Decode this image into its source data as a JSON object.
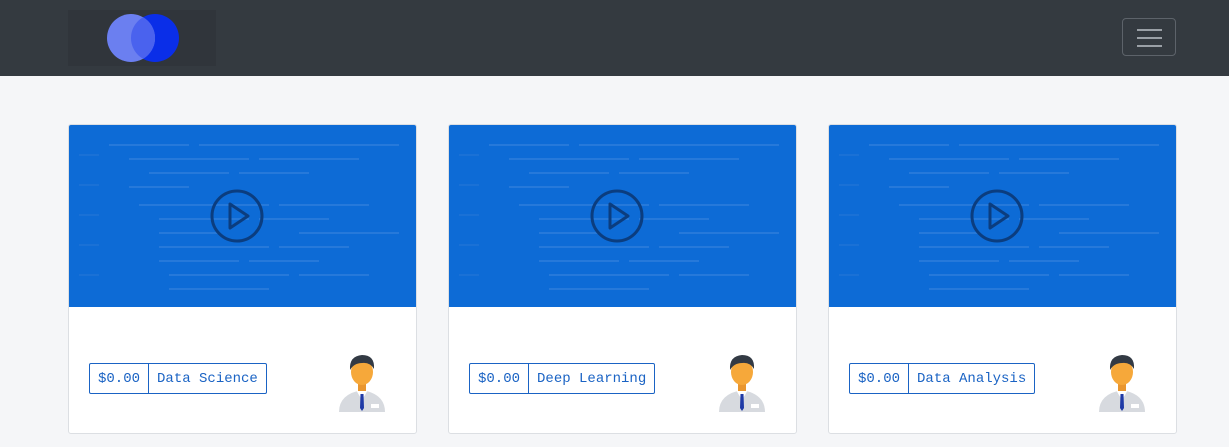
{
  "navbar": {
    "logo_icon": "overlapping-circles-logo",
    "menu_icon": "hamburger-menu-icon",
    "colors": {
      "background": "#343a40",
      "logo_left": "#6b7ff0",
      "logo_right": "#0a2ee8"
    }
  },
  "courses": [
    {
      "price": "$0.00",
      "category": "Data Science",
      "thumbnail_icon": "play-icon",
      "instructor_icon": "avatar-icon"
    },
    {
      "price": "$0.00",
      "category": "Deep Learning",
      "thumbnail_icon": "play-icon",
      "instructor_icon": "avatar-icon"
    },
    {
      "price": "$0.00",
      "category": "Data Analysis",
      "thumbnail_icon": "play-icon",
      "instructor_icon": "avatar-icon"
    }
  ],
  "colors": {
    "thumbnail": "#0d6bd6",
    "tag": "#1a63c4",
    "page_background": "#f5f6f8"
  }
}
